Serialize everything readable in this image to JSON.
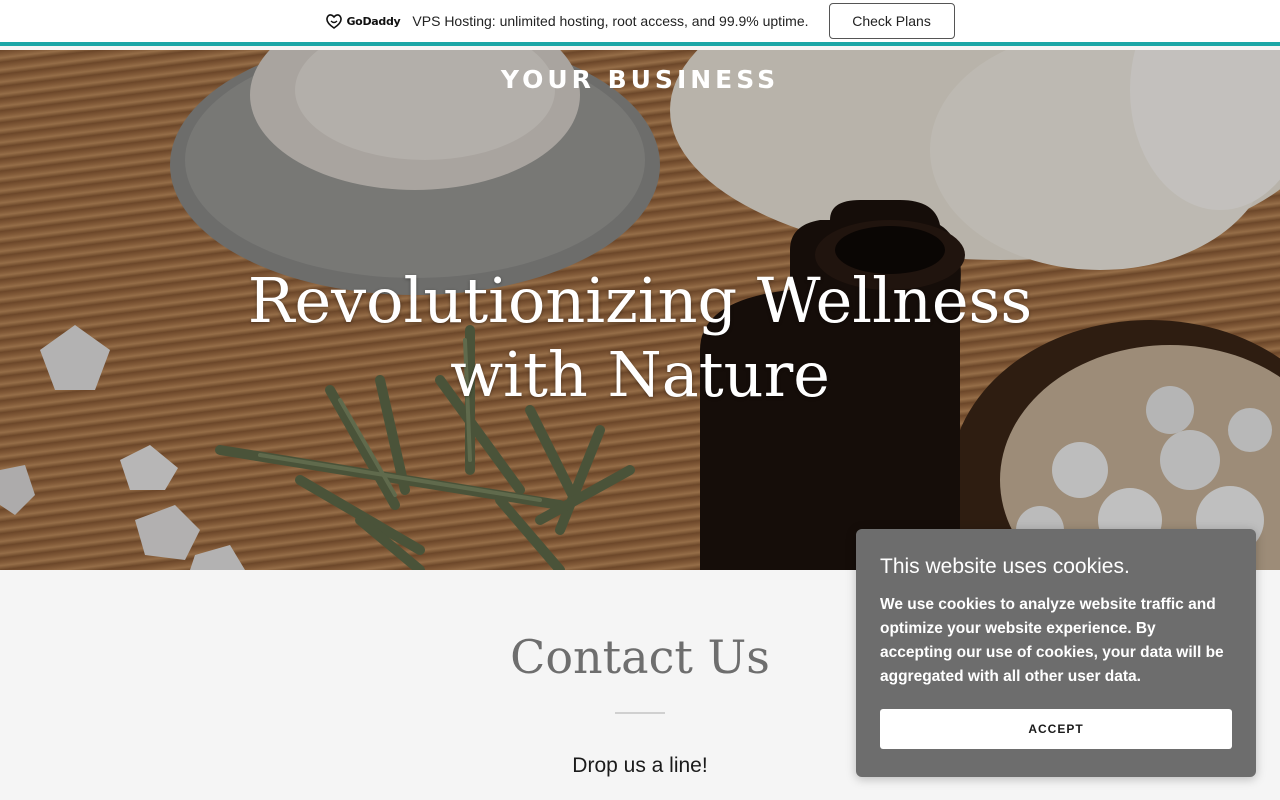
{
  "promo": {
    "logo_text": "GoDaddy",
    "message": "VPS Hosting: unlimited hosting, root access, and 99.9% uptime.",
    "button_label": "Check Plans",
    "accent_color": "#1ba6a6"
  },
  "hero": {
    "brand": "YOUR BUSINESS",
    "headline_line1": "Revolutionizing Wellness",
    "headline_line2": "with Nature"
  },
  "contact": {
    "title": "Contact Us",
    "subtitle": "Drop us a line!"
  },
  "cookie": {
    "title": "This website uses cookies.",
    "body": "We use cookies to analyze website traffic and optimize your website experience. By accepting our use of cookies, your data will be aggregated with all other user data.",
    "accept_label": "ACCEPT"
  }
}
